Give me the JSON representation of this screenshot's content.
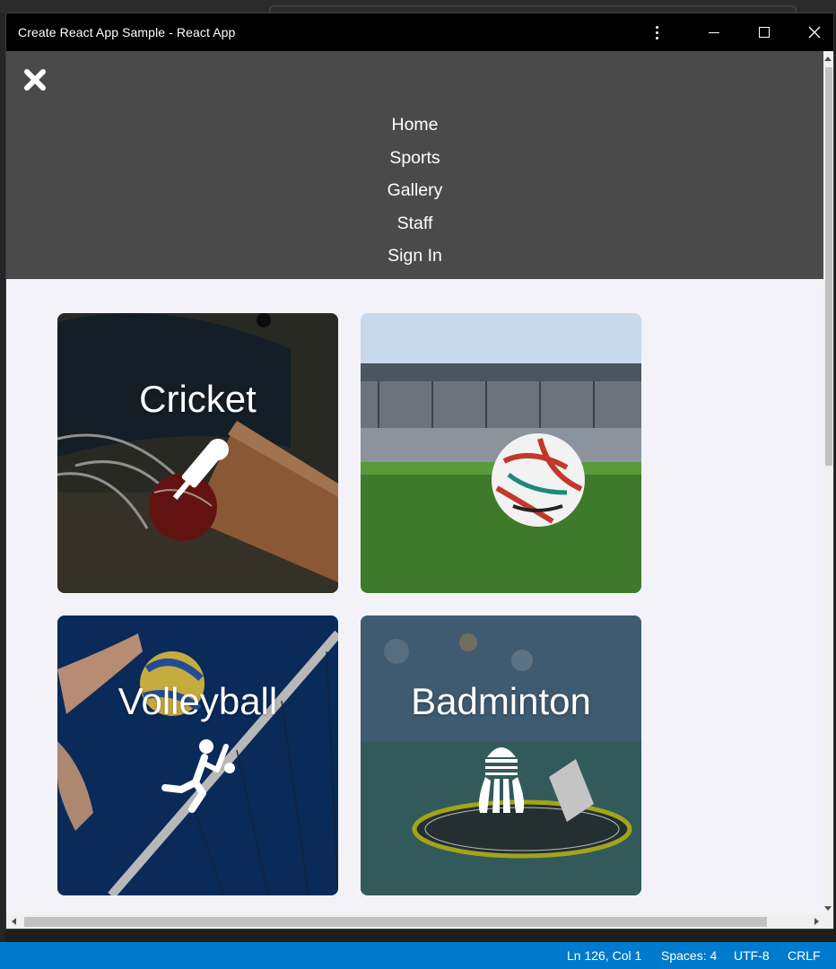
{
  "window": {
    "title": "Create React App Sample - React App"
  },
  "titlebar_icons": {
    "more": "more-vertical-icon",
    "minimize": "minimize-icon",
    "maximize": "maximize-icon",
    "close": "close-icon"
  },
  "nav": {
    "close_icon": "close-icon",
    "links": [
      "Home",
      "Sports",
      "Gallery",
      "Staff",
      "Sign In"
    ]
  },
  "cards": [
    {
      "title": "Cricket",
      "icon": "cricket-icon"
    },
    {
      "title": "",
      "icon": ""
    },
    {
      "title": "Volleyball",
      "icon": "volleyball-player-icon"
    },
    {
      "title": "Badminton",
      "icon": "shuttlecock-icon"
    }
  ],
  "statusbar": {
    "position": "Ln 126, Col 1",
    "spaces": "Spaces: 4",
    "encoding": "UTF-8",
    "eol": "CRLF"
  },
  "colors": {
    "navbar": "#4a4a4a",
    "page_bg": "#f3f2f8",
    "statusbar": "#007acc",
    "titlebar": "#000000"
  }
}
